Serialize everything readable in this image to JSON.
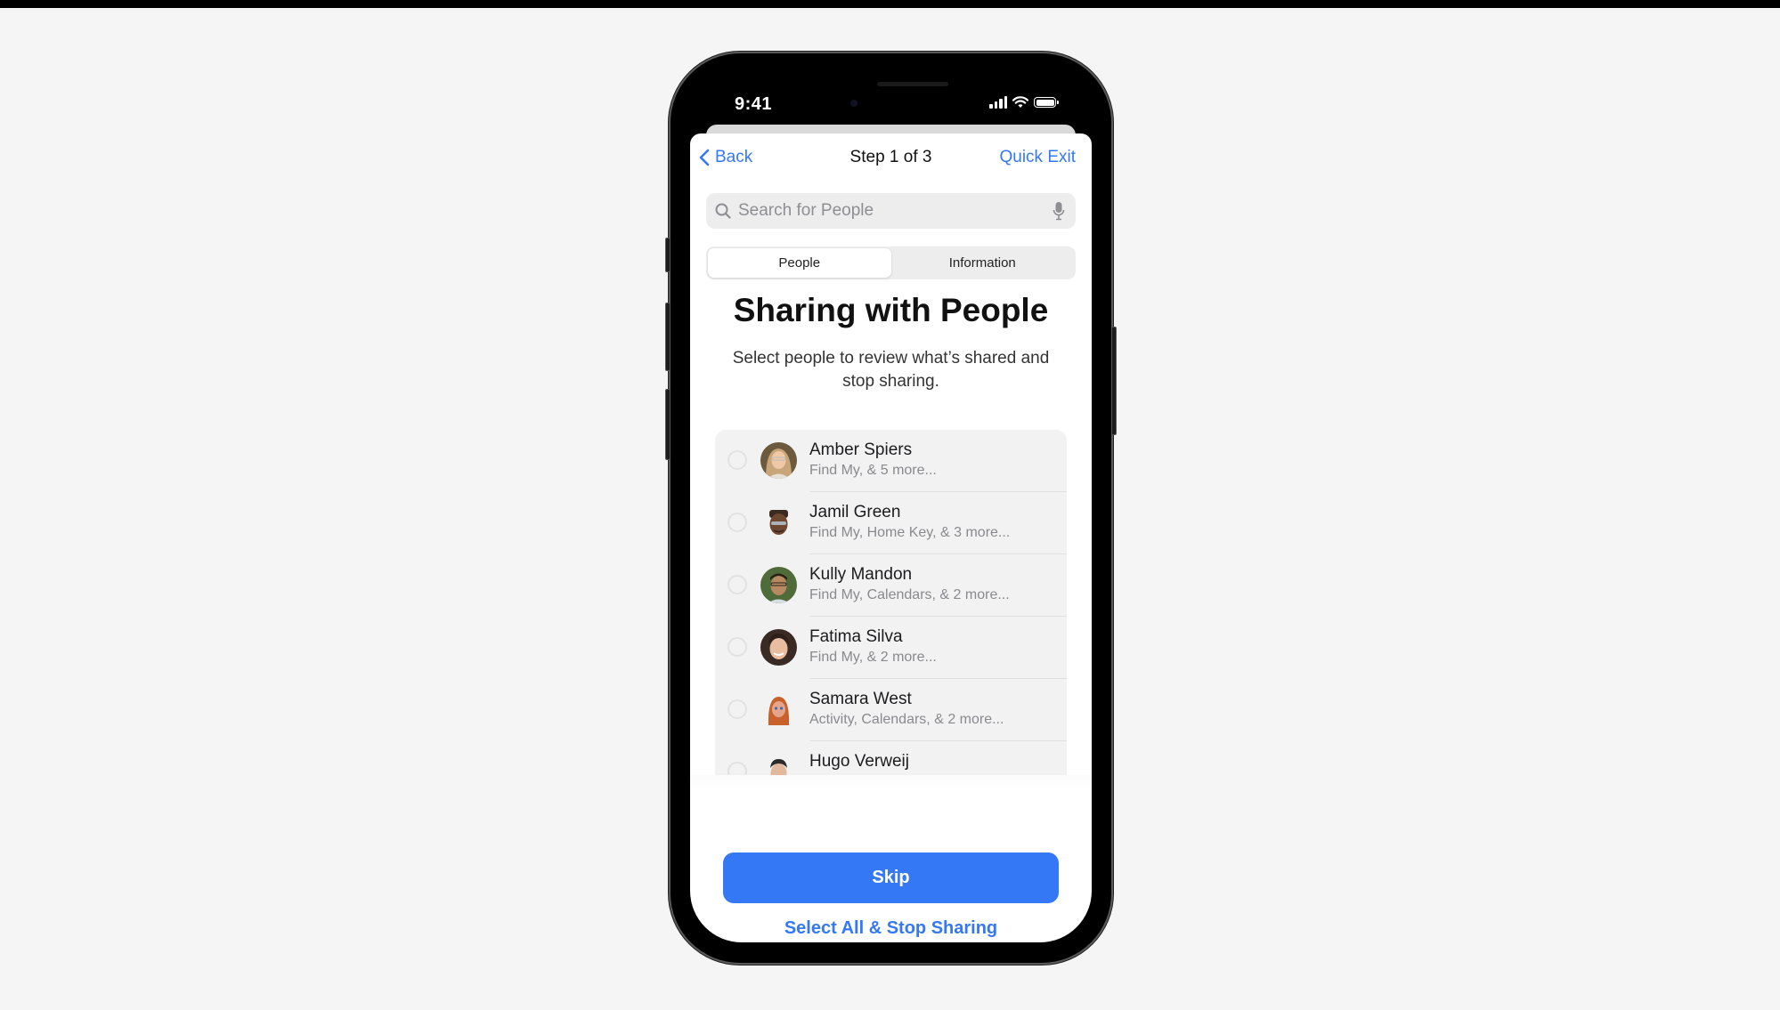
{
  "status_bar": {
    "time": "9:41",
    "icons": [
      "cellular-signal-icon",
      "wifi-icon",
      "battery-icon"
    ]
  },
  "nav": {
    "back_label": "Back",
    "title": "Step 1 of 3",
    "quick_exit_label": "Quick Exit"
  },
  "search": {
    "placeholder": "Search for People",
    "value": ""
  },
  "segments": [
    {
      "label": "People",
      "selected": true
    },
    {
      "label": "Information",
      "selected": false
    }
  ],
  "heading": "Sharing with People",
  "subtext": "Select people to review what’s shared and stop sharing.",
  "people": [
    {
      "name": "Amber Spiers",
      "detail": "Find My, & 5 more...",
      "selected": false,
      "avatar": "photo"
    },
    {
      "name": "Jamil Green",
      "detail": "Find My, Home Key, & 3 more...",
      "selected": false,
      "avatar": "memoji"
    },
    {
      "name": "Kully Mandon",
      "detail": "Find My, Calendars, & 2 more...",
      "selected": false,
      "avatar": "photo"
    },
    {
      "name": "Fatima Silva",
      "detail": "Find My, & 2 more...",
      "selected": false,
      "avatar": "photo"
    },
    {
      "name": "Samara West",
      "detail": "Activity, Calendars, & 2 more...",
      "selected": false,
      "avatar": "memoji"
    },
    {
      "name": "Hugo Verweij",
      "detail": "",
      "selected": false,
      "avatar": "photo"
    }
  ],
  "actions": {
    "skip_label": "Skip",
    "select_all_label": "Select All & Stop Sharing"
  },
  "colors": {
    "accent": "#3478f6",
    "background": "#f5f5f5"
  }
}
